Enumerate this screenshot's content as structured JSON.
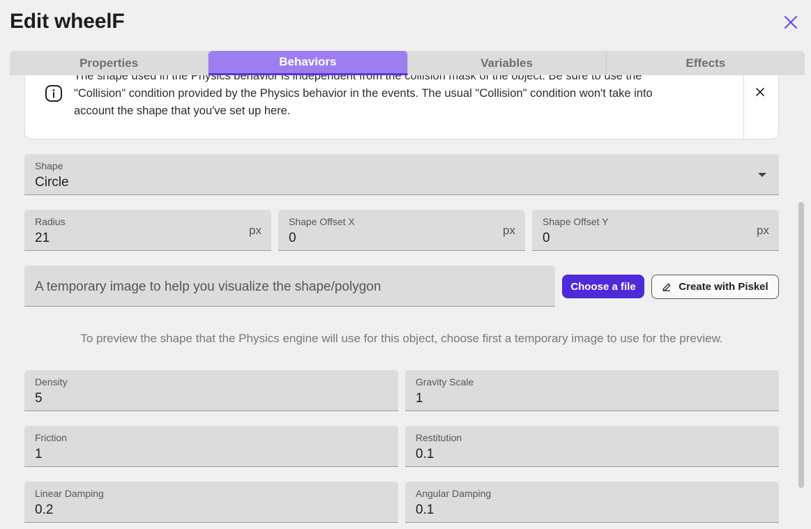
{
  "dialog": {
    "title": "Edit wheelF",
    "close_icon": "close-icon"
  },
  "tabs": [
    {
      "label": "Properties",
      "active": false
    },
    {
      "label": "Behaviors",
      "active": true
    },
    {
      "label": "Variables",
      "active": false
    },
    {
      "label": "Effects",
      "active": false
    }
  ],
  "notice": {
    "line1": "The shape used in the Physics behavior is independent from the collision mask of the object. Be sure to use the",
    "line2": "\"Collision\" condition provided by the Physics behavior in the events. The usual \"Collision\" condition won't take into",
    "line3": "account the shape that you've set up here."
  },
  "shape": {
    "label": "Shape",
    "value": "Circle"
  },
  "radius": {
    "label": "Radius",
    "value": "21",
    "unit": "px"
  },
  "offset_x": {
    "label": "Shape Offset X",
    "value": "0",
    "unit": "px"
  },
  "offset_y": {
    "label": "Shape Offset Y",
    "value": "0",
    "unit": "px"
  },
  "image": {
    "placeholder": "A temporary image to help you visualize the shape/polygon"
  },
  "buttons": {
    "choose_file": "Choose a file",
    "create_piskel": "Create with Piskel"
  },
  "hint": "To preview the shape that the Physics engine will use for this object, choose first a temporary image to use for the preview.",
  "density": {
    "label": "Density",
    "value": "5"
  },
  "gravity_scale": {
    "label": "Gravity Scale",
    "value": "1"
  },
  "friction": {
    "label": "Friction",
    "value": "1"
  },
  "restitution": {
    "label": "Restitution",
    "value": "0.1"
  },
  "linear_damping": {
    "label": "Linear Damping",
    "value": "0.2"
  },
  "angular_damping": {
    "label": "Angular Damping",
    "value": "0.1"
  },
  "colors": {
    "accent": "#9b7ff0",
    "primary_button": "#4f2ad8",
    "close": "#6b4ce6"
  }
}
